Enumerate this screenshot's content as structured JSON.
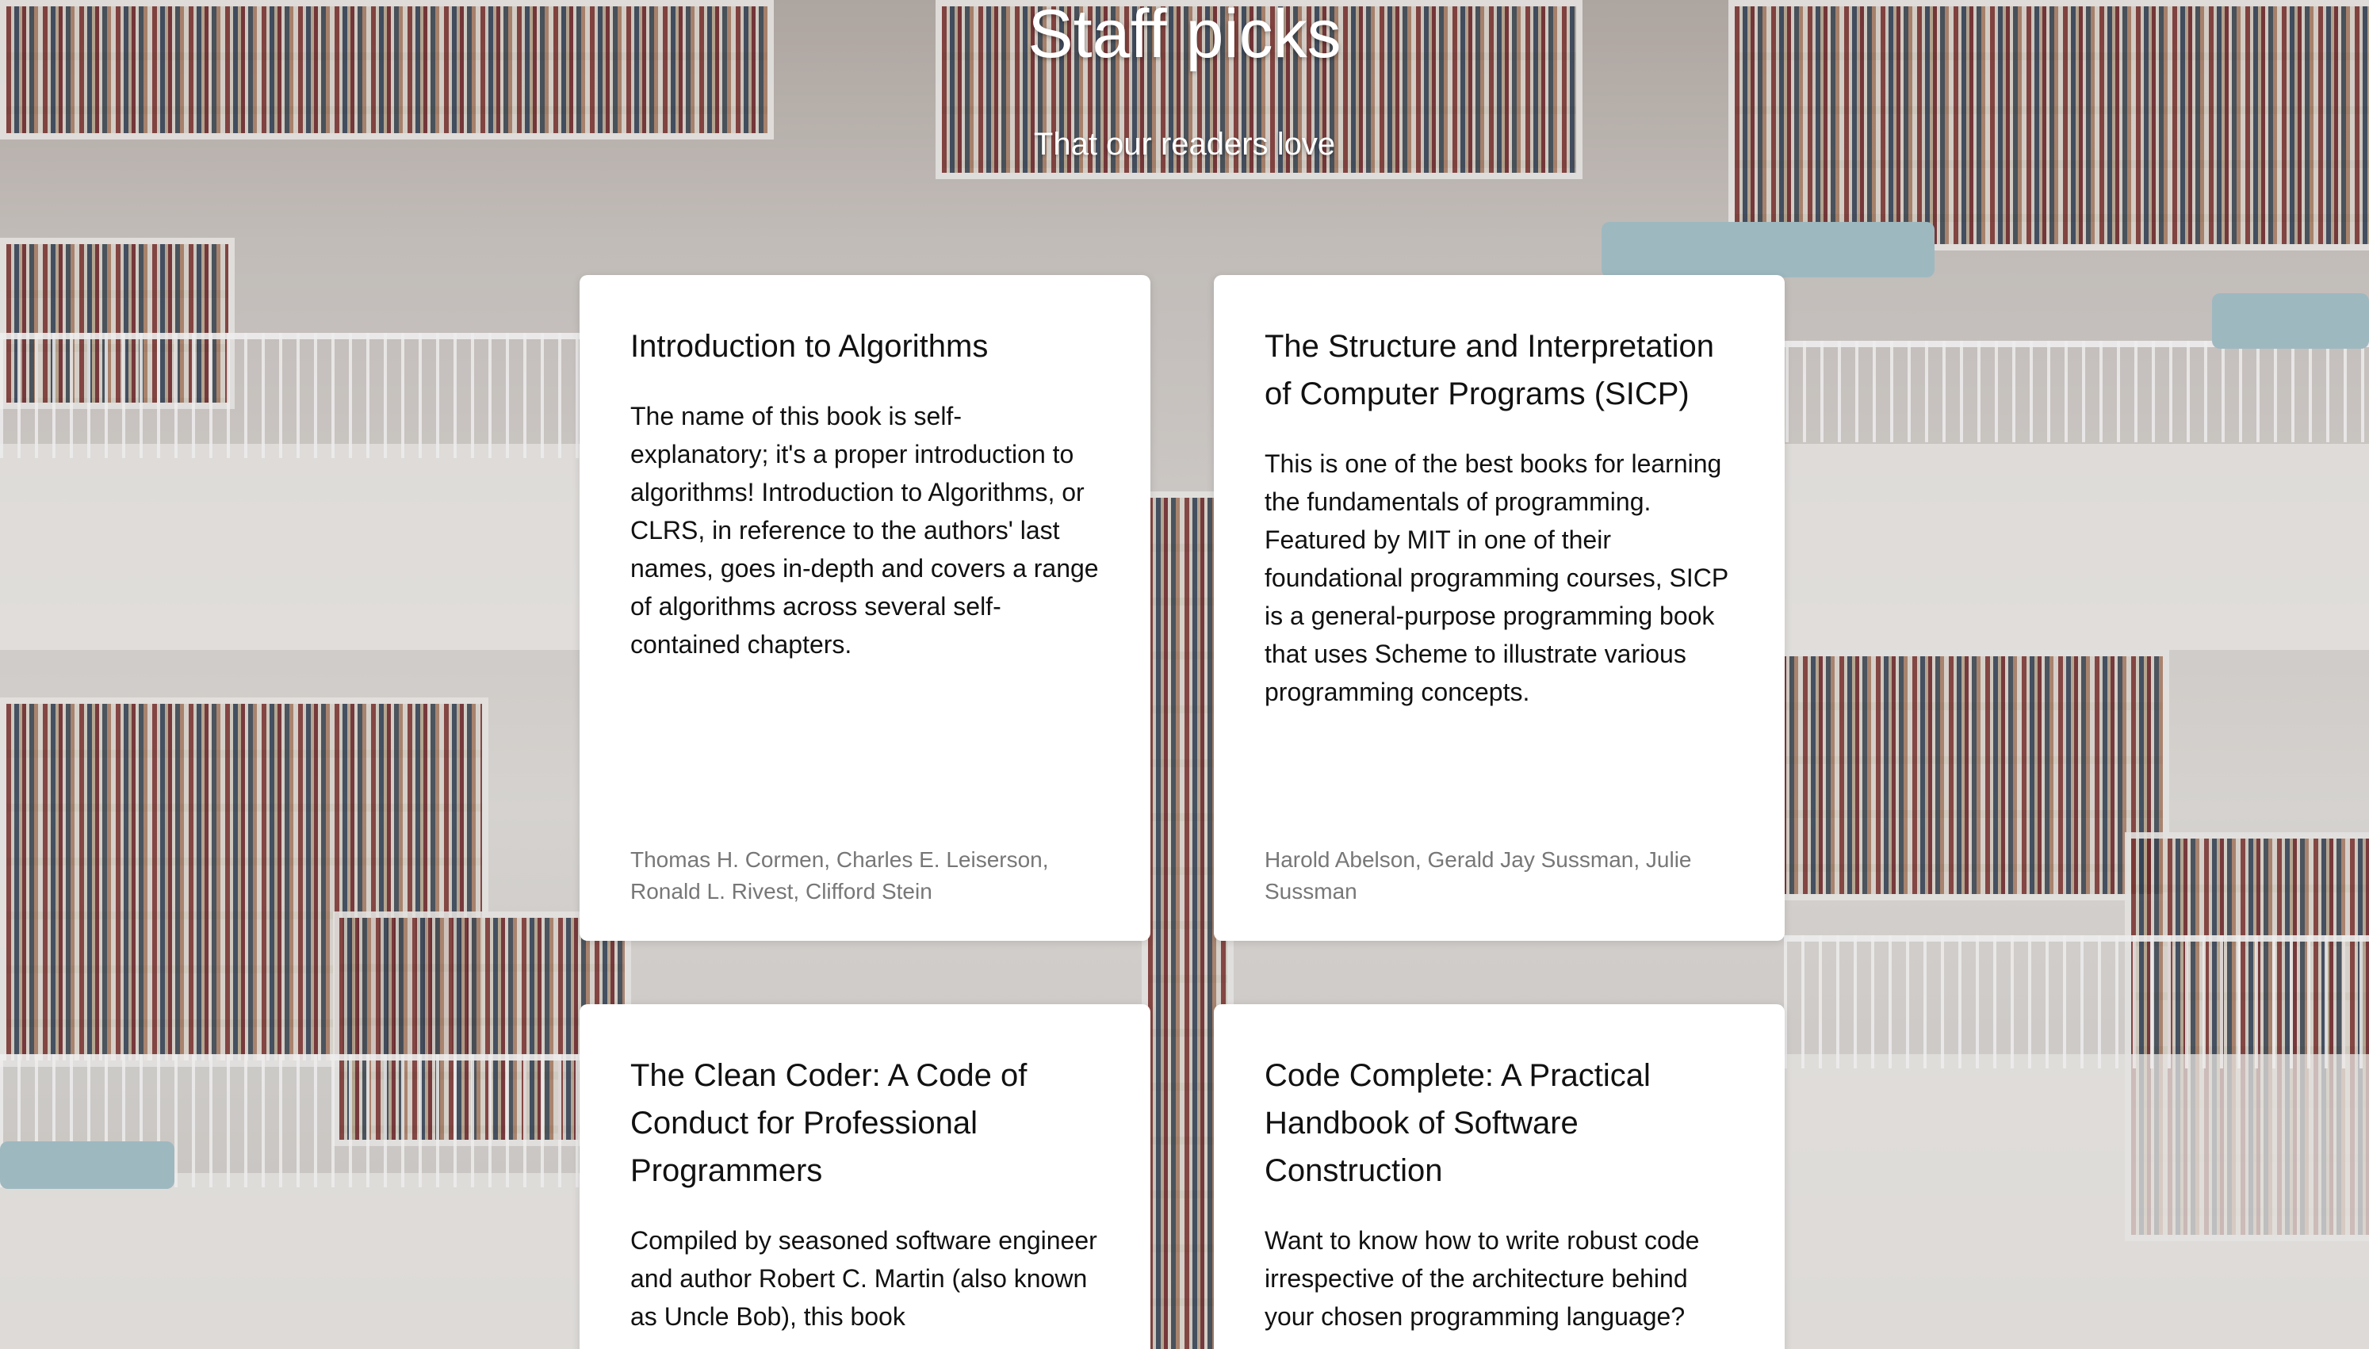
{
  "header": {
    "title": "Staff picks",
    "subtitle": "That our readers love"
  },
  "cards": [
    {
      "title": "Introduction to Algorithms",
      "description": "The name of this book is self-explanatory; it's a proper introduction to algorithms! Introduction to Algorithms, or CLRS, in reference to the authors' last names, goes in-depth and covers a range of algorithms across several self-contained chapters.",
      "authors": "Thomas H. Cormen, Charles E. Leiserson, Ronald L. Rivest, Clifford Stein"
    },
    {
      "title": "The Structure and Interpretation of Computer Programs (SICP)",
      "description": "This is one of the best books for learning the fundamentals of programming. Featured by MIT in one of their foundational programming courses, SICP is a general-purpose programming book that uses Scheme to illustrate various programming concepts.",
      "authors": "Harold Abelson, Gerald Jay Sussman, Julie Sussman"
    },
    {
      "title": "The Clean Coder: A Code of Conduct for Professional Programmers",
      "description": "Compiled by seasoned software engineer and author Robert C. Martin (also known as Uncle Bob), this book"
    },
    {
      "title": "Code Complete: A Practical Handbook of Software Construction",
      "description": "Want to know how to write robust code irrespective of the architecture behind your chosen programming language?"
    }
  ]
}
